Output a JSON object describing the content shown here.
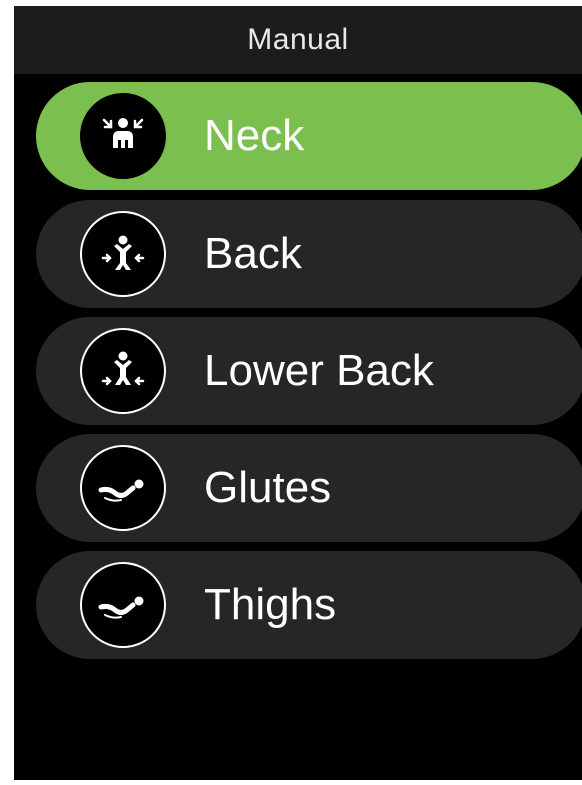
{
  "header": {
    "title": "Manual"
  },
  "menu": {
    "items": [
      {
        "label": "Neck",
        "icon": "neck-massage-icon",
        "selected": true
      },
      {
        "label": "Back",
        "icon": "back-massage-icon",
        "selected": false
      },
      {
        "label": "Lower Back",
        "icon": "lower-back-massage-icon",
        "selected": false
      },
      {
        "label": "Glutes",
        "icon": "reclined-body-icon",
        "selected": false
      },
      {
        "label": "Thighs",
        "icon": "reclined-body-icon",
        "selected": false
      }
    ]
  },
  "colors": {
    "background": "#000000",
    "header": "#1c1c1c",
    "item": "#262626",
    "accent": "#7bbf4e",
    "text": "#ffffff"
  }
}
